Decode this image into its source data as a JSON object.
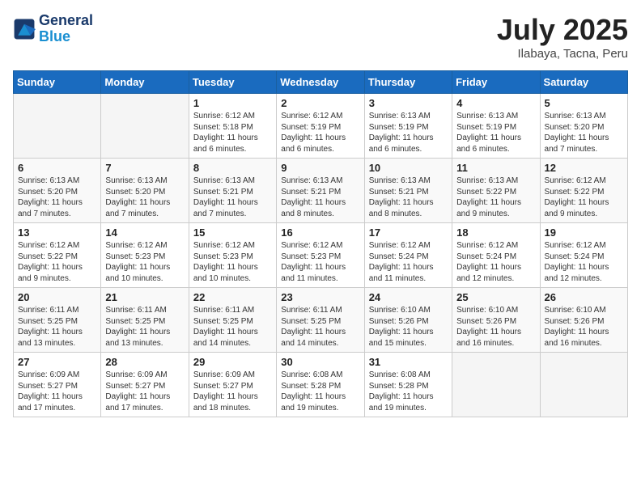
{
  "header": {
    "logo_line1": "General",
    "logo_line2": "Blue",
    "month_title": "July 2025",
    "location": "Ilabaya, Tacna, Peru"
  },
  "weekdays": [
    "Sunday",
    "Monday",
    "Tuesday",
    "Wednesday",
    "Thursday",
    "Friday",
    "Saturday"
  ],
  "weeks": [
    [
      {
        "day": "",
        "info": ""
      },
      {
        "day": "",
        "info": ""
      },
      {
        "day": "1",
        "info": "Sunrise: 6:12 AM\nSunset: 5:18 PM\nDaylight: 11 hours and 6 minutes."
      },
      {
        "day": "2",
        "info": "Sunrise: 6:12 AM\nSunset: 5:19 PM\nDaylight: 11 hours and 6 minutes."
      },
      {
        "day": "3",
        "info": "Sunrise: 6:13 AM\nSunset: 5:19 PM\nDaylight: 11 hours and 6 minutes."
      },
      {
        "day": "4",
        "info": "Sunrise: 6:13 AM\nSunset: 5:19 PM\nDaylight: 11 hours and 6 minutes."
      },
      {
        "day": "5",
        "info": "Sunrise: 6:13 AM\nSunset: 5:20 PM\nDaylight: 11 hours and 7 minutes."
      }
    ],
    [
      {
        "day": "6",
        "info": "Sunrise: 6:13 AM\nSunset: 5:20 PM\nDaylight: 11 hours and 7 minutes."
      },
      {
        "day": "7",
        "info": "Sunrise: 6:13 AM\nSunset: 5:20 PM\nDaylight: 11 hours and 7 minutes."
      },
      {
        "day": "8",
        "info": "Sunrise: 6:13 AM\nSunset: 5:21 PM\nDaylight: 11 hours and 7 minutes."
      },
      {
        "day": "9",
        "info": "Sunrise: 6:13 AM\nSunset: 5:21 PM\nDaylight: 11 hours and 8 minutes."
      },
      {
        "day": "10",
        "info": "Sunrise: 6:13 AM\nSunset: 5:21 PM\nDaylight: 11 hours and 8 minutes."
      },
      {
        "day": "11",
        "info": "Sunrise: 6:13 AM\nSunset: 5:22 PM\nDaylight: 11 hours and 9 minutes."
      },
      {
        "day": "12",
        "info": "Sunrise: 6:12 AM\nSunset: 5:22 PM\nDaylight: 11 hours and 9 minutes."
      }
    ],
    [
      {
        "day": "13",
        "info": "Sunrise: 6:12 AM\nSunset: 5:22 PM\nDaylight: 11 hours and 9 minutes."
      },
      {
        "day": "14",
        "info": "Sunrise: 6:12 AM\nSunset: 5:23 PM\nDaylight: 11 hours and 10 minutes."
      },
      {
        "day": "15",
        "info": "Sunrise: 6:12 AM\nSunset: 5:23 PM\nDaylight: 11 hours and 10 minutes."
      },
      {
        "day": "16",
        "info": "Sunrise: 6:12 AM\nSunset: 5:23 PM\nDaylight: 11 hours and 11 minutes."
      },
      {
        "day": "17",
        "info": "Sunrise: 6:12 AM\nSunset: 5:24 PM\nDaylight: 11 hours and 11 minutes."
      },
      {
        "day": "18",
        "info": "Sunrise: 6:12 AM\nSunset: 5:24 PM\nDaylight: 11 hours and 12 minutes."
      },
      {
        "day": "19",
        "info": "Sunrise: 6:12 AM\nSunset: 5:24 PM\nDaylight: 11 hours and 12 minutes."
      }
    ],
    [
      {
        "day": "20",
        "info": "Sunrise: 6:11 AM\nSunset: 5:25 PM\nDaylight: 11 hours and 13 minutes."
      },
      {
        "day": "21",
        "info": "Sunrise: 6:11 AM\nSunset: 5:25 PM\nDaylight: 11 hours and 13 minutes."
      },
      {
        "day": "22",
        "info": "Sunrise: 6:11 AM\nSunset: 5:25 PM\nDaylight: 11 hours and 14 minutes."
      },
      {
        "day": "23",
        "info": "Sunrise: 6:11 AM\nSunset: 5:25 PM\nDaylight: 11 hours and 14 minutes."
      },
      {
        "day": "24",
        "info": "Sunrise: 6:10 AM\nSunset: 5:26 PM\nDaylight: 11 hours and 15 minutes."
      },
      {
        "day": "25",
        "info": "Sunrise: 6:10 AM\nSunset: 5:26 PM\nDaylight: 11 hours and 16 minutes."
      },
      {
        "day": "26",
        "info": "Sunrise: 6:10 AM\nSunset: 5:26 PM\nDaylight: 11 hours and 16 minutes."
      }
    ],
    [
      {
        "day": "27",
        "info": "Sunrise: 6:09 AM\nSunset: 5:27 PM\nDaylight: 11 hours and 17 minutes."
      },
      {
        "day": "28",
        "info": "Sunrise: 6:09 AM\nSunset: 5:27 PM\nDaylight: 11 hours and 17 minutes."
      },
      {
        "day": "29",
        "info": "Sunrise: 6:09 AM\nSunset: 5:27 PM\nDaylight: 11 hours and 18 minutes."
      },
      {
        "day": "30",
        "info": "Sunrise: 6:08 AM\nSunset: 5:28 PM\nDaylight: 11 hours and 19 minutes."
      },
      {
        "day": "31",
        "info": "Sunrise: 6:08 AM\nSunset: 5:28 PM\nDaylight: 11 hours and 19 minutes."
      },
      {
        "day": "",
        "info": ""
      },
      {
        "day": "",
        "info": ""
      }
    ]
  ]
}
